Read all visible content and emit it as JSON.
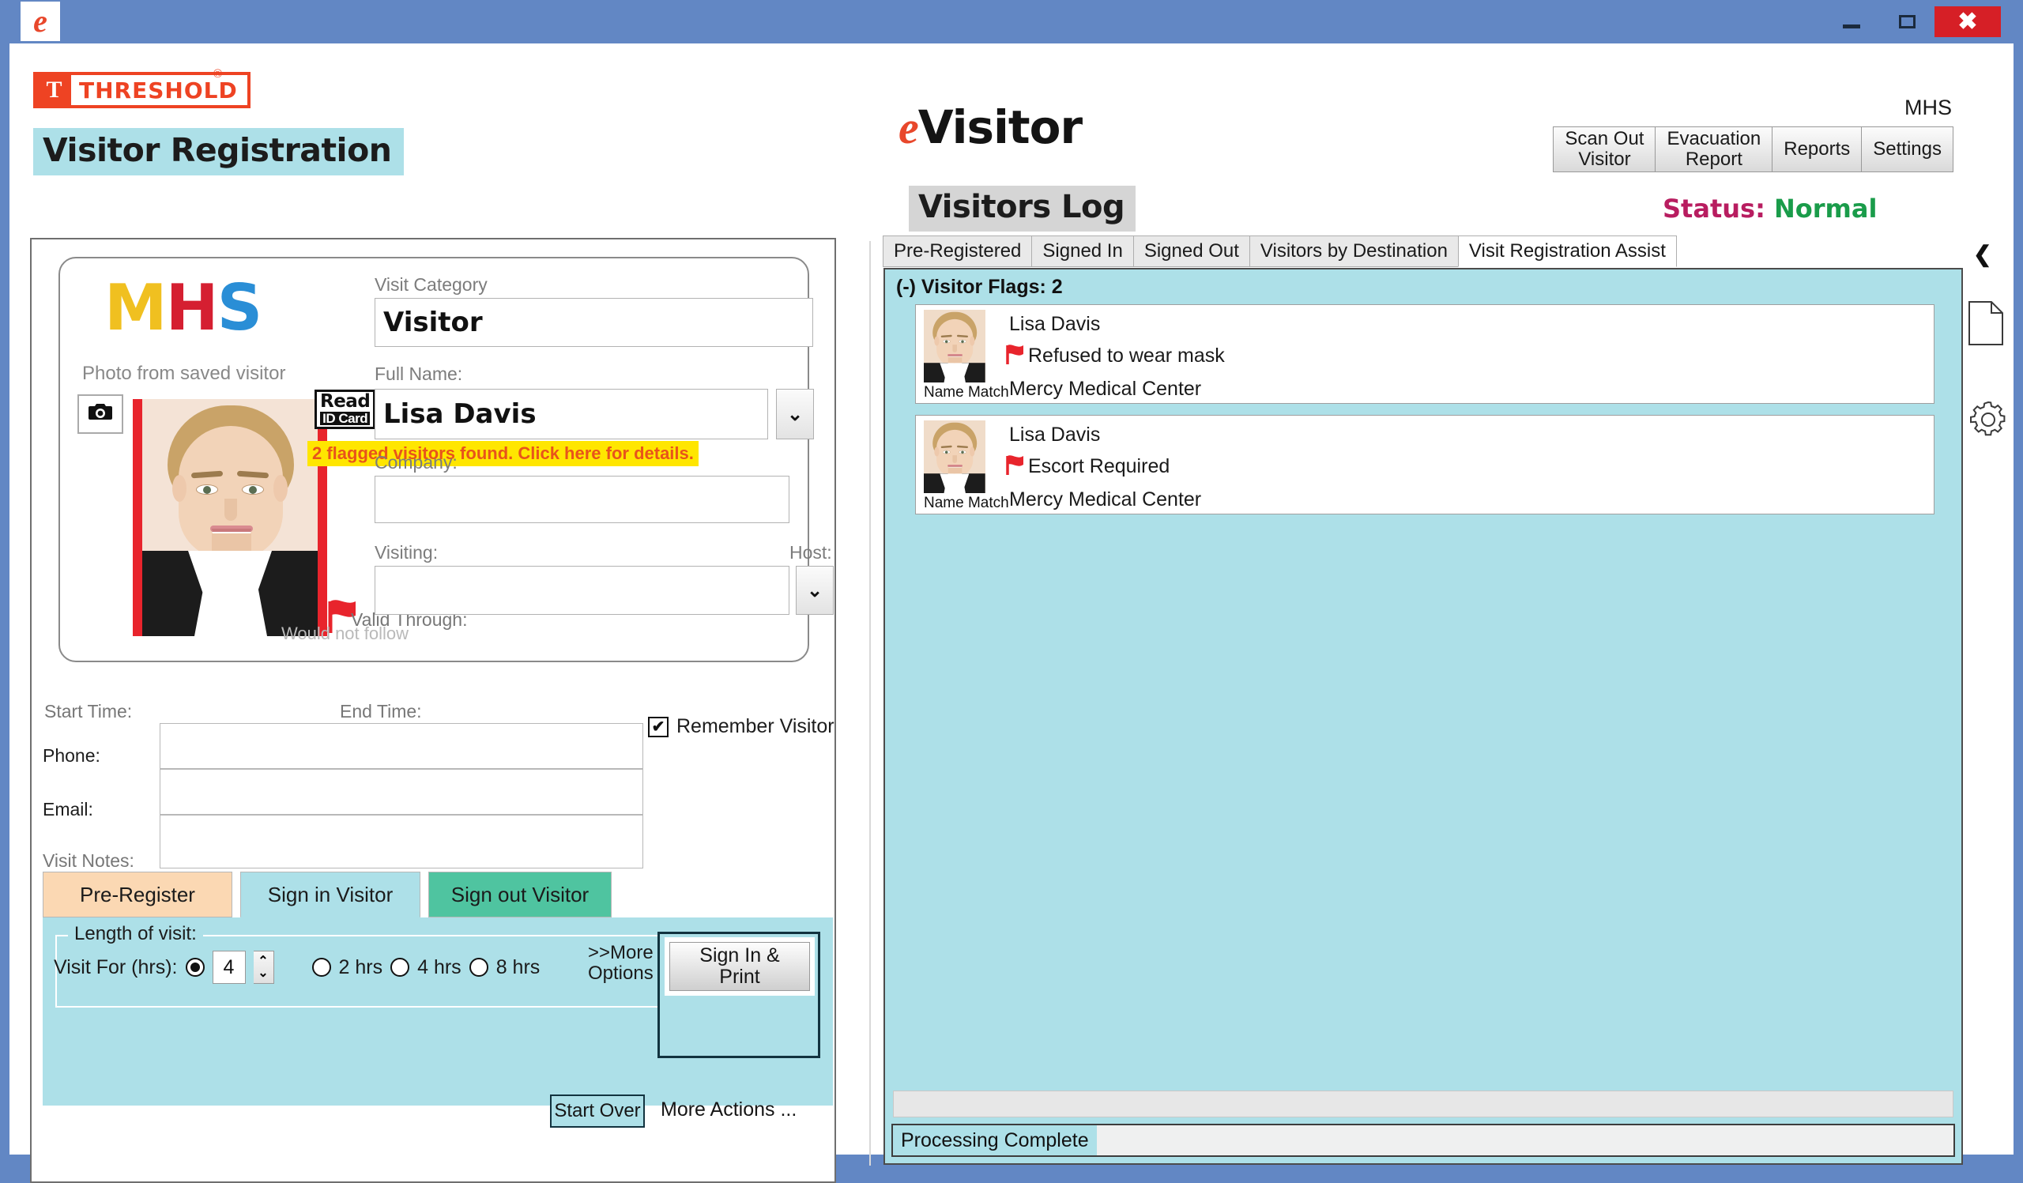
{
  "window": {
    "app_icon": "evisitor-e-icon",
    "minimize_label": "minimize-icon",
    "maximize_label": "maximize-icon",
    "close_label": "✖"
  },
  "left": {
    "brand": {
      "mark": "T",
      "word": "THRESHOLD",
      "registered": "®"
    },
    "page_title": "Visitor Registration",
    "photo_card": {
      "org_logo": {
        "part1": "M",
        "part2": "H",
        "part3": "S"
      },
      "caption": "Photo from saved visitor",
      "camera_icon": "camera-icon",
      "read_id_line1": "Read",
      "read_id_line2": "ID Card",
      "flag_icon": "red-flag-icon",
      "flag_note": "Would not follow"
    },
    "fields": {
      "visit_category_label": "Visit Category",
      "visit_category_value": "Visitor",
      "full_name_label": "Full Name:",
      "full_name_value": "Lisa Davis",
      "flag_banner": "2 flagged visitors found. Click here for details.",
      "company_label": "Company:",
      "company_value": "",
      "visiting_label": "Visiting:",
      "visiting_value": "",
      "host_label": "Host:",
      "valid_through_label": "Valid Through:",
      "start_time_label": "Start Time:",
      "end_time_label": "End Time:",
      "phone_label": "Phone:",
      "phone_value": "",
      "email_label": "Email:",
      "email_value": "",
      "visit_notes_label": "Visit Notes:",
      "visit_notes_value": "",
      "remember_visitor_label": "Remember Visitor",
      "remember_visitor_checked": "✔",
      "dropdown_icon": "chevron-down-icon"
    },
    "mode_tabs": [
      {
        "label": "Pre-Register",
        "color": "#fbd8b3",
        "active": false
      },
      {
        "label": "Sign in Visitor",
        "color": "#ade0e8",
        "active": true
      },
      {
        "label": "Sign out Visitor",
        "color": "#4fc4a0",
        "active": false
      }
    ],
    "visit_panel": {
      "group_title": "Length of visit:",
      "visit_for_label": "Visit For (hrs):",
      "custom_hours_value": "4",
      "custom_selected": true,
      "presets": [
        {
          "label": "2 hrs",
          "selected": false
        },
        {
          "label": "4 hrs",
          "selected": false
        },
        {
          "label": "8 hrs",
          "selected": false
        }
      ],
      "more_options_line1": ">>More",
      "more_options_line2": "Options",
      "sign_in_print_line1": "Sign In &",
      "sign_in_print_line2": "Print",
      "start_over_label": "Start Over",
      "more_actions_label": "More Actions ..."
    }
  },
  "right": {
    "logo_e": "e",
    "logo_word": "Visitor",
    "site_code": "MHS",
    "top_buttons": [
      {
        "line1": "Scan Out",
        "line2": "Visitor"
      },
      {
        "line1": "Evacuation",
        "line2": "Report"
      },
      {
        "line1": "Reports",
        "line2": ""
      },
      {
        "line1": "Settings",
        "line2": ""
      }
    ],
    "section_title": "Visitors Log",
    "status_label": "Status:",
    "status_value": "Normal",
    "status_label_color": "#b81d60",
    "status_value_color": "#1a9c4a",
    "tabs": [
      {
        "label": "Pre-Registered",
        "active": false
      },
      {
        "label": "Signed In",
        "active": false
      },
      {
        "label": "Signed Out",
        "active": false
      },
      {
        "label": "Visitors by Destination",
        "active": false
      },
      {
        "label": "Visit Registration Assist",
        "active": true
      }
    ],
    "collapse_icon": "chevron-left-icon",
    "side_icons": [
      "document-icon",
      "gear-icon"
    ],
    "flags_header": "(-) Visitor Flags: 2",
    "flag_cards": [
      {
        "name": "Lisa Davis",
        "flag": "Refused to wear mask",
        "org": "Mercy Medical Center",
        "match_label": "Name Match",
        "flag_icon": "red-flag-icon"
      },
      {
        "name": "Lisa Davis",
        "flag": "Escort Required",
        "org": "Mercy Medical Center",
        "match_label": "Name Match",
        "flag_icon": "red-flag-icon"
      }
    ],
    "status_bar_text": "Processing Complete"
  }
}
